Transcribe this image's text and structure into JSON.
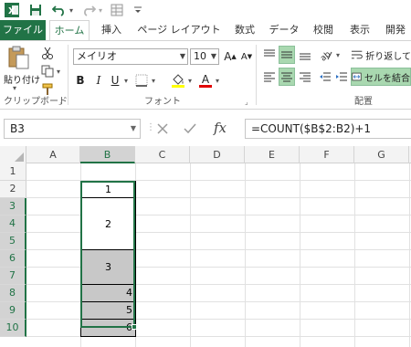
{
  "colors": {
    "accent": "#217346",
    "file_tab_bg": "#217346",
    "selected_fill": "#c8c8c8",
    "font_color_bar": "#e00000"
  },
  "tabs": [
    {
      "label": "ファイル"
    },
    {
      "label": "ホーム"
    },
    {
      "label": "挿入"
    },
    {
      "label": "ページ レイアウト"
    },
    {
      "label": "数式"
    },
    {
      "label": "データ"
    },
    {
      "label": "校閲"
    },
    {
      "label": "表示"
    },
    {
      "label": "開発"
    }
  ],
  "ribbon": {
    "paste_label": "貼り付け",
    "clipboard_group": "クリップボード",
    "font_group": "フォント",
    "alignment_group": "配置",
    "font_name": "メイリオ",
    "font_size": "10",
    "grow_font": "A",
    "shrink_font": "A",
    "bold": "B",
    "italic": "I",
    "underline": "U",
    "font_color_letter": "A",
    "wrap_text": "折り返して",
    "merge_cells": "セルを結合"
  },
  "formula_bar": {
    "name_box": "B3",
    "fx": "fx",
    "formula": "=COUNT($B$2:B2)+1"
  },
  "grid": {
    "columns": [
      "A",
      "B",
      "C",
      "D",
      "E",
      "F",
      "G"
    ],
    "selected_column": "B",
    "rows": [
      "1",
      "2",
      "3",
      "4",
      "5",
      "6",
      "7",
      "8",
      "9",
      "10"
    ],
    "selected_rows": [
      "3",
      "4",
      "5",
      "6",
      "7",
      "8",
      "9",
      "10"
    ],
    "cells": {
      "b2": "1",
      "b3_merged": "2",
      "b6_merged": "3",
      "b8": "4",
      "b9": "5",
      "b10": "6"
    }
  }
}
